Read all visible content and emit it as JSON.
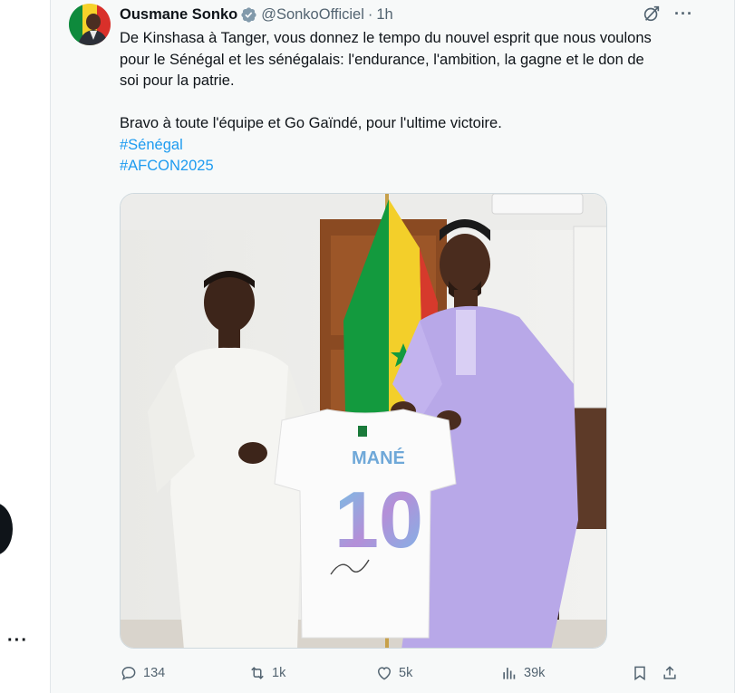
{
  "author": {
    "name": "Ousmane Sonko",
    "handle": "@SonkoOfficiel",
    "separator": "·",
    "time": "1h"
  },
  "tweet": {
    "paragraph1": "De Kinshasa à Tanger, vous donnez le tempo du nouvel esprit que nous voulons pour le Sénégal et les sénégalais: l'endurance, l'ambition, la gagne et le don de soi pour la patrie.",
    "paragraph2": "Bravo à toute l'équipe et Go Gaïndé, pour l'ultime victoire.",
    "hashtags": [
      "#Sénégal",
      "#AFCON2025"
    ]
  },
  "media": {
    "jersey_name": "MANÉ",
    "jersey_number": "10"
  },
  "actions": {
    "replies": "134",
    "reposts": "1k",
    "likes": "5k",
    "views": "39k"
  },
  "icons": {
    "verified": "verified-badge-icon",
    "grok": "grok-icon",
    "more": "more-icon"
  },
  "colors": {
    "accent": "#1d9bf0",
    "text": "#0f1419",
    "muted": "#536471",
    "background": "#f7f9f9"
  }
}
